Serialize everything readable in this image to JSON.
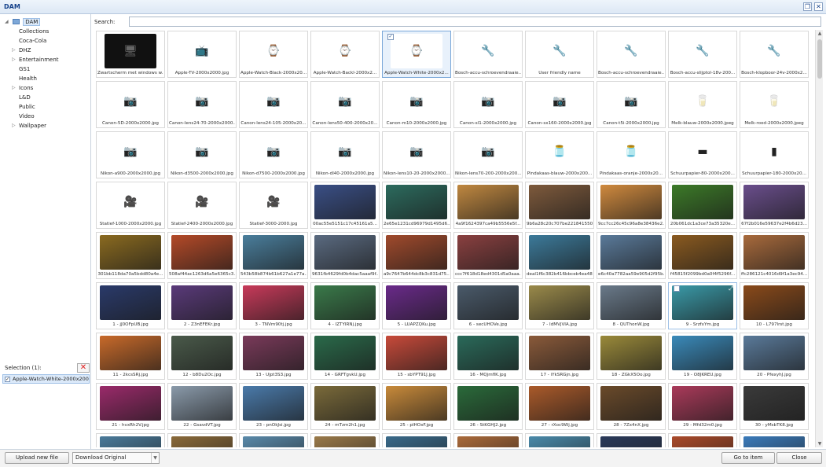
{
  "window": {
    "title": "DAM"
  },
  "tree": {
    "root": "DAM",
    "items": [
      {
        "label": "Collections",
        "expandable": false
      },
      {
        "label": "Coca-Cola",
        "expandable": false
      },
      {
        "label": "DHZ",
        "expandable": true
      },
      {
        "label": "Entertainment",
        "expandable": true
      },
      {
        "label": "GS1",
        "expandable": false
      },
      {
        "label": "Health",
        "expandable": false
      },
      {
        "label": "Icons",
        "expandable": true
      },
      {
        "label": "L&D",
        "expandable": false
      },
      {
        "label": "Public",
        "expandable": false
      },
      {
        "label": "Video",
        "expandable": false
      },
      {
        "label": "Wallpaper",
        "expandable": true
      }
    ]
  },
  "selection": {
    "label": "Selection (1):",
    "items": [
      "Apple-Watch-White-2000x2000.jpg"
    ]
  },
  "search": {
    "label": "Search:",
    "value": ""
  },
  "tiles": [
    {
      "caption": "Zwartscherm met windows w...",
      "icon": "🖥",
      "bg": "#111111"
    },
    {
      "caption": "Apple-TV-2000x2000.jpg",
      "icon": "📺",
      "bg": "#ffffff"
    },
    {
      "caption": "Apple-Watch-Black-2000x20...",
      "icon": "⌚",
      "bg": "#ffffff"
    },
    {
      "caption": "Apple-Watch-Backl-2000x2...",
      "icon": "⌚",
      "bg": "#ffffff"
    },
    {
      "caption": "Apple-Watch-White-2000x2...",
      "icon": "⌚",
      "bg": "#ffffff",
      "selected": true
    },
    {
      "caption": "Bosch-accu-schroevendraaie...",
      "icon": "🔧",
      "bg": "#ffffff"
    },
    {
      "caption": "User friendly name",
      "icon": "🔧",
      "bg": "#ffffff"
    },
    {
      "caption": "Bosch-accu-schroevendraaie...",
      "icon": "🔧",
      "bg": "#ffffff"
    },
    {
      "caption": "Bosch-accu-slijptol-18v-200...",
      "icon": "🔧",
      "bg": "#ffffff"
    },
    {
      "caption": "Bosch-klopboor-24v-2000x2...",
      "icon": "🔧",
      "bg": "#ffffff"
    },
    {
      "caption": "Canon-5D-2000x2000.jpg",
      "icon": "📷",
      "bg": "#ffffff"
    },
    {
      "caption": "Canon-lens24-70-2000x2000...",
      "icon": "📷",
      "bg": "#ffffff"
    },
    {
      "caption": "Canon-lens24-105-2000x20...",
      "icon": "📷",
      "bg": "#ffffff"
    },
    {
      "caption": "Canon-lens50-400-2000x20...",
      "icon": "📷",
      "bg": "#ffffff"
    },
    {
      "caption": "Canon-m10-2000x2000.jpg",
      "icon": "📷",
      "bg": "#ffffff"
    },
    {
      "caption": "Canon-sl1-2000x2000.jpg",
      "icon": "📷",
      "bg": "#ffffff"
    },
    {
      "caption": "Canon-sx160-2000x2000.jpg",
      "icon": "📷",
      "bg": "#ffffff"
    },
    {
      "caption": "Canon-t5i-2000x2000.jpg",
      "icon": "📷",
      "bg": "#ffffff"
    },
    {
      "caption": "Melk-blauw-2000x2000.jpeg",
      "icon": "🥛",
      "bg": "#ffffff"
    },
    {
      "caption": "Melk-rood-2000x2000.jpeg",
      "icon": "🥛",
      "bg": "#ffffff"
    },
    {
      "caption": "Nikon-a900-2000x2000.jpg",
      "icon": "📷",
      "bg": "#ffffff"
    },
    {
      "caption": "Nikon-d3500-2000x2000.jpg",
      "icon": "📷",
      "bg": "#ffffff"
    },
    {
      "caption": "Nikon-d7500-2000x2000.jpg",
      "icon": "📷",
      "bg": "#ffffff"
    },
    {
      "caption": "Nikon-dl40-2000x2000.jpg",
      "icon": "📷",
      "bg": "#ffffff"
    },
    {
      "caption": "Nikon-lens10-20-2000x2000...",
      "icon": "📷",
      "bg": "#ffffff"
    },
    {
      "caption": "Nikon-lens70-200-2000x200...",
      "icon": "📷",
      "bg": "#ffffff"
    },
    {
      "caption": "Pindakaas-blauw-2000x200...",
      "icon": "🫙",
      "bg": "#ffffff"
    },
    {
      "caption": "Pindakaas-oranje-2000x20...",
      "icon": "🫙",
      "bg": "#ffffff"
    },
    {
      "caption": "Schuurpapier-80-2000x200...",
      "icon": "▬",
      "bg": "#ffffff"
    },
    {
      "caption": "Schuurpapier-180-2000x20...",
      "icon": "▮",
      "bg": "#ffffff"
    },
    {
      "caption": "Statief-1000-2000x2000.jpg",
      "icon": "🎥",
      "bg": "#ffffff"
    },
    {
      "caption": "Statief-2400-2000x2000.jpg",
      "icon": "🎥",
      "bg": "#ffffff"
    },
    {
      "caption": "Statief-3000-2000.jpg",
      "icon": "🎥",
      "bg": "#ffffff"
    },
    {
      "caption": "00ac55e5151c17c45161a5...",
      "bg": "#3a4f86",
      "photo": true
    },
    {
      "caption": "2e65e1231cd96979d1495d6...",
      "bg": "#2c6b5e",
      "photo": true
    },
    {
      "caption": "4a9f1624397ca49b5556e5f...",
      "bg": "#c08840",
      "photo": true
    },
    {
      "caption": "9b6a28c20c707be221841550...",
      "bg": "#7e5a3c",
      "photo": true
    },
    {
      "caption": "9cc7cc26c45c96a8e38436e2...",
      "bg": "#d08a3e",
      "photo": true
    },
    {
      "caption": "20b061dc1a3ce73a35320e...",
      "bg": "#3c7a28",
      "photo": true
    },
    {
      "caption": "67f2b016e59637e2f4b6d23...",
      "bg": "#6a4e8c",
      "photo": true
    },
    {
      "caption": "301bb118da70a5bdd80a4e...",
      "bg": "#8a6a20",
      "photo": true
    },
    {
      "caption": "508af44ac1263d6a5e6365c3...",
      "bg": "#b44a28",
      "photo": true
    },
    {
      "caption": "543b58b874b61b627a1e77a...",
      "bg": "#4a7e9c",
      "photo": true
    },
    {
      "caption": "9631fb4629fd0b4dac5aaaf9f...",
      "bg": "#5a6a80",
      "photo": true
    },
    {
      "caption": "a9c7647b644dc8b3c831d75...",
      "bg": "#a04a2c",
      "photo": true
    },
    {
      "caption": "ccc7f618d18ed4301d5a0aaa...",
      "bg": "#8a4040",
      "photo": true
    },
    {
      "caption": "deal1f6c382b416bbceb4ea48...",
      "bg": "#3c7a9a",
      "photo": true
    },
    {
      "caption": "e6c40a7782aa59e905d2f95b...",
      "bg": "#5a7a9a",
      "photo": true
    },
    {
      "caption": "f45815f2099bd0a0f4f5296f...",
      "bg": "#8a5a20",
      "photo": true
    },
    {
      "caption": "ffc286121c4016d9f1a3ec94...",
      "bg": "#a86a3c",
      "photo": true
    },
    {
      "caption": "1 - jJ0OFpUB.jpg",
      "bg": "#2a3a6a",
      "photo": true
    },
    {
      "caption": "2 - Z3nEFEKr.jpg",
      "bg": "#5a3a7a",
      "photo": true
    },
    {
      "caption": "3 - TNVm90tj.jpg",
      "bg": "#c83a5a",
      "photo": true
    },
    {
      "caption": "4 - IZTYIRNj.jpg",
      "bg": "#3a7a4a",
      "photo": true
    },
    {
      "caption": "5 - LUAPZQKu.jpg",
      "bg": "#6a2a8a",
      "photo": true
    },
    {
      "caption": "6 - secUHOVe.jpg",
      "bg": "#4a5a6a",
      "photo": true
    },
    {
      "caption": "7 - IdMVjVIA.jpg",
      "bg": "#9a8a4a",
      "photo": true
    },
    {
      "caption": "8 - QUThonW.jpg",
      "bg": "#6a7a8a",
      "photo": true
    },
    {
      "caption": "9 - SrzfxYm.jpg",
      "bg": "#3a9aa8",
      "photo": true,
      "hover": true
    },
    {
      "caption": "10 - L797lrst.jpg",
      "bg": "#8a4a1a",
      "photo": true
    },
    {
      "caption": "11 - 2kcsSRj.jpg",
      "bg": "#c86a2a",
      "photo": true
    },
    {
      "caption": "12 - b8Du2Oc.jpg",
      "bg": "#4a5a4a",
      "photo": true
    },
    {
      "caption": "13 - Ujpt3S3.jpg",
      "bg": "#7a3a5a",
      "photo": true
    },
    {
      "caption": "14 - GRFTgvkU.jpg",
      "bg": "#2a6a4a",
      "photo": true
    },
    {
      "caption": "15 - sbYPT91J.jpg",
      "bg": "#c84a3a",
      "photo": true
    },
    {
      "caption": "16 - MQjmflK.jpg",
      "bg": "#2a6a5a",
      "photo": true
    },
    {
      "caption": "17 - iYkSRGjn.jpg",
      "bg": "#8a5a3a",
      "photo": true
    },
    {
      "caption": "18 - ZGkX5Oo.jpg",
      "bg": "#9a8a3a",
      "photo": true
    },
    {
      "caption": "19 - O8JKREU.jpg",
      "bg": "#3a8aba",
      "photo": true
    },
    {
      "caption": "20 - PfexyhJ.jpg",
      "bg": "#5a7a9a",
      "photo": true
    },
    {
      "caption": "21 - hvxRh2V.jpg",
      "bg": "#9a2a6a",
      "photo": true
    },
    {
      "caption": "22 - GsavdVT.jpg",
      "bg": "#8a9aaa",
      "photo": true
    },
    {
      "caption": "23 - pnOkJsi.jpg",
      "bg": "#4a7aaa",
      "photo": true
    },
    {
      "caption": "24 - mTzm2h1.jpg",
      "bg": "#7a6a3a",
      "photo": true
    },
    {
      "caption": "25 - pIHOxF.jpg",
      "bg": "#c88a3a",
      "photo": true
    },
    {
      "caption": "26 - StKGHJ2.jpg",
      "bg": "#2a6a3a",
      "photo": true
    },
    {
      "caption": "27 - rXoc9Wj.jpg",
      "bg": "#aa5a2a",
      "photo": true
    },
    {
      "caption": "28 - 7Zx4nX.jpg",
      "bg": "#6a4a2a",
      "photo": true
    },
    {
      "caption": "29 - Mfd32m0.jpg",
      "bg": "#aa3a5a",
      "photo": true
    },
    {
      "caption": "30 - yMsbTK8.jpg",
      "bg": "#3a3a3a",
      "photo": true
    },
    {
      "caption": "",
      "bg": "#4a7a9a",
      "photo": true
    },
    {
      "caption": "",
      "bg": "#8a6a3a",
      "photo": true
    },
    {
      "caption": "",
      "bg": "#5a8aaa",
      "photo": true
    },
    {
      "caption": "",
      "bg": "#9a7a4a",
      "photo": true
    },
    {
      "caption": "",
      "bg": "#3a6a8a",
      "photo": true
    },
    {
      "caption": "",
      "bg": "#aa6a3a",
      "photo": true
    },
    {
      "caption": "",
      "bg": "#4a8aaa",
      "photo": true
    },
    {
      "caption": "",
      "bg": "#2a3a5a",
      "photo": true
    },
    {
      "caption": "",
      "bg": "#aa4a2a",
      "photo": true
    },
    {
      "caption": "",
      "bg": "#3a7aba",
      "photo": true
    }
  ],
  "footer": {
    "upload_label": "Upload new file",
    "download_label": "Download Original",
    "goto_label": "Go to item",
    "close_label": "Close"
  }
}
